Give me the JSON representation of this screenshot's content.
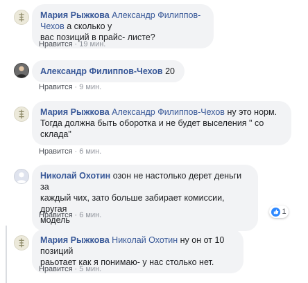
{
  "comments": [
    {
      "author": "Мария Рыжкова",
      "mention": "Александр Филиппов-Чехов",
      "text_lines": [
        "а сколько у",
        "вас позиций в прайс- листе?"
      ],
      "like_label": "Нравится",
      "sep": "·",
      "time": "19 мин.",
      "avatar": "emblem-avatar"
    },
    {
      "author": "Александр Филиппов-Чехов",
      "text": "20",
      "like_label": "Нравится",
      "sep": "·",
      "time": "9 мин.",
      "avatar": "person-avatar"
    },
    {
      "author": "Мария Рыжкова",
      "mention": "Александр Филиппов-Чехов",
      "text_lines": [
        "ну это норм.",
        "Тогда должна быть оборотка и не будет выселения \" со",
        "склада\""
      ],
      "like_label": "Нравится",
      "sep": "·",
      "time": "6 мин.",
      "avatar": "emblem-avatar"
    },
    {
      "author": "Николай Охотин",
      "text_lines": [
        "озон не настолько дерет деньги за",
        "каждый чих, зато больше забирает комиссии, другая",
        "модель"
      ],
      "like_label": "Нравится",
      "sep": "·",
      "time": "6 мин.",
      "avatar": "default-avatar",
      "reaction_count": "1"
    },
    {
      "author": "Мария Рыжкова",
      "mention": "Николай Охотин",
      "text_lines": [
        "ну он от 10 позиций",
        "раьотает как я понимаю- у нас столько нет."
      ],
      "like_label": "Нравится",
      "sep": "·",
      "time": "5 мин.",
      "avatar": "emblem-avatar"
    }
  ],
  "colors": {
    "link": "#385898",
    "bubble": "#f2f3f5",
    "meta": "#90949c",
    "like_blue": "#2d88ff"
  }
}
